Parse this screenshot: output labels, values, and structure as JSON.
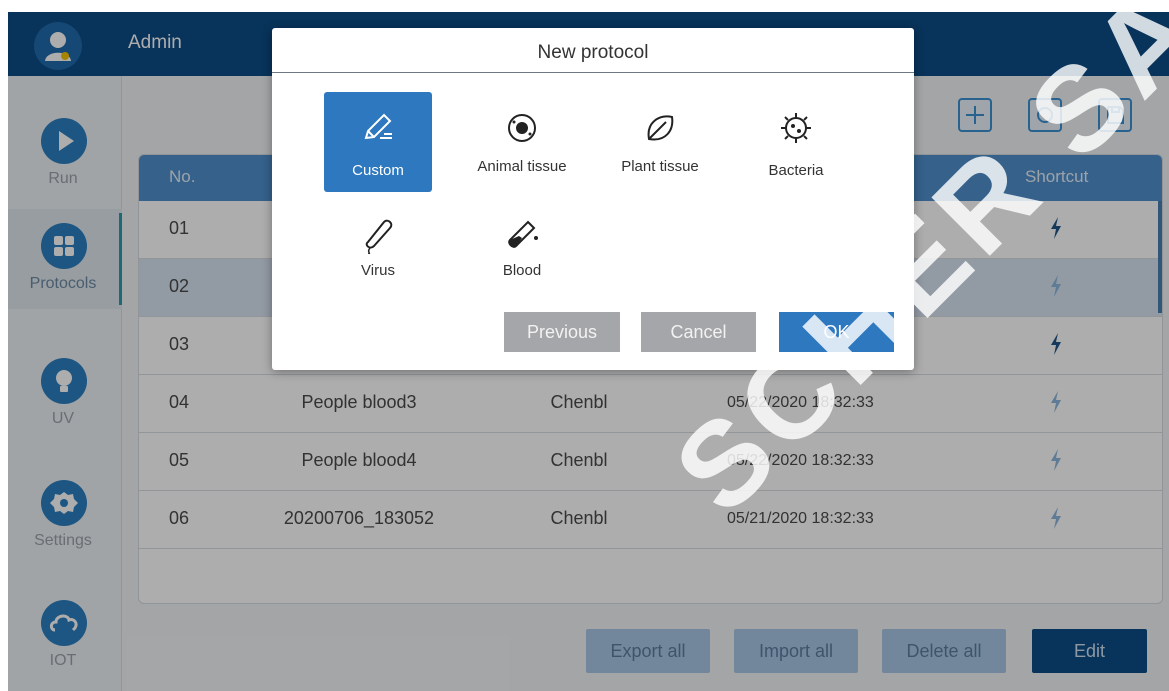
{
  "header": {
    "user_name": "Admin"
  },
  "sidebar": {
    "items": [
      {
        "label": "Run",
        "icon": "play-icon"
      },
      {
        "label": "Protocols",
        "icon": "grid-icon",
        "active": true
      },
      {
        "label": "UV",
        "icon": "bulb-icon"
      },
      {
        "label": "Settings",
        "icon": "gear-icon"
      },
      {
        "label": "IOT",
        "icon": "cloud-icon"
      }
    ]
  },
  "toolbar": {
    "icons": [
      "plus-icon",
      "search-icon",
      "export-icon"
    ]
  },
  "table": {
    "columns": {
      "no": "No.",
      "shortcut": "Shortcut"
    },
    "rows": [
      {
        "no": "01",
        "name": "",
        "creator": "",
        "time": "",
        "shortcut_active": true
      },
      {
        "no": "02",
        "name": "",
        "creator": "",
        "time": "",
        "shortcut_active": false,
        "selected": true
      },
      {
        "no": "03",
        "name": "",
        "creator": "",
        "time": "",
        "shortcut_active": true
      },
      {
        "no": "04",
        "name": "People blood3",
        "creator": "Chenbl",
        "time": "05/22/2020 18:32:33",
        "shortcut_active": false
      },
      {
        "no": "05",
        "name": "People blood4",
        "creator": "Chenbl",
        "time": "05/22/2020 18:32:33",
        "shortcut_active": false
      },
      {
        "no": "06",
        "name": "20200706_183052",
        "creator": "Chenbl",
        "time": "05/21/2020 18:32:33",
        "shortcut_active": false
      }
    ]
  },
  "actions": {
    "export_all": "Export all",
    "import_all": "Import all",
    "delete_all": "Delete all",
    "edit": "Edit"
  },
  "modal": {
    "title": "New protocol",
    "types": [
      {
        "label": "Custom",
        "icon": "pencil-icon",
        "selected": true
      },
      {
        "label": "Animal tissue",
        "icon": "cell-icon"
      },
      {
        "label": "Plant tissue",
        "icon": "leaf-icon"
      },
      {
        "label": "Bacteria",
        "icon": "bacteria-icon"
      },
      {
        "label": "Virus",
        "icon": "virus-icon"
      },
      {
        "label": "Blood",
        "icon": "blood-tube-icon"
      }
    ],
    "buttons": {
      "previous": "Previous",
      "cancel": "Cancel",
      "ok": "OK"
    }
  },
  "watermark": {
    "text": "SCHER SA"
  },
  "colors": {
    "topbar": "#0d4c85",
    "accent_blue": "#2e78bf",
    "header_blue": "#4f8fcd",
    "shortcut_active": "#1f5687",
    "shortcut_inactive": "#8cb6dc"
  }
}
